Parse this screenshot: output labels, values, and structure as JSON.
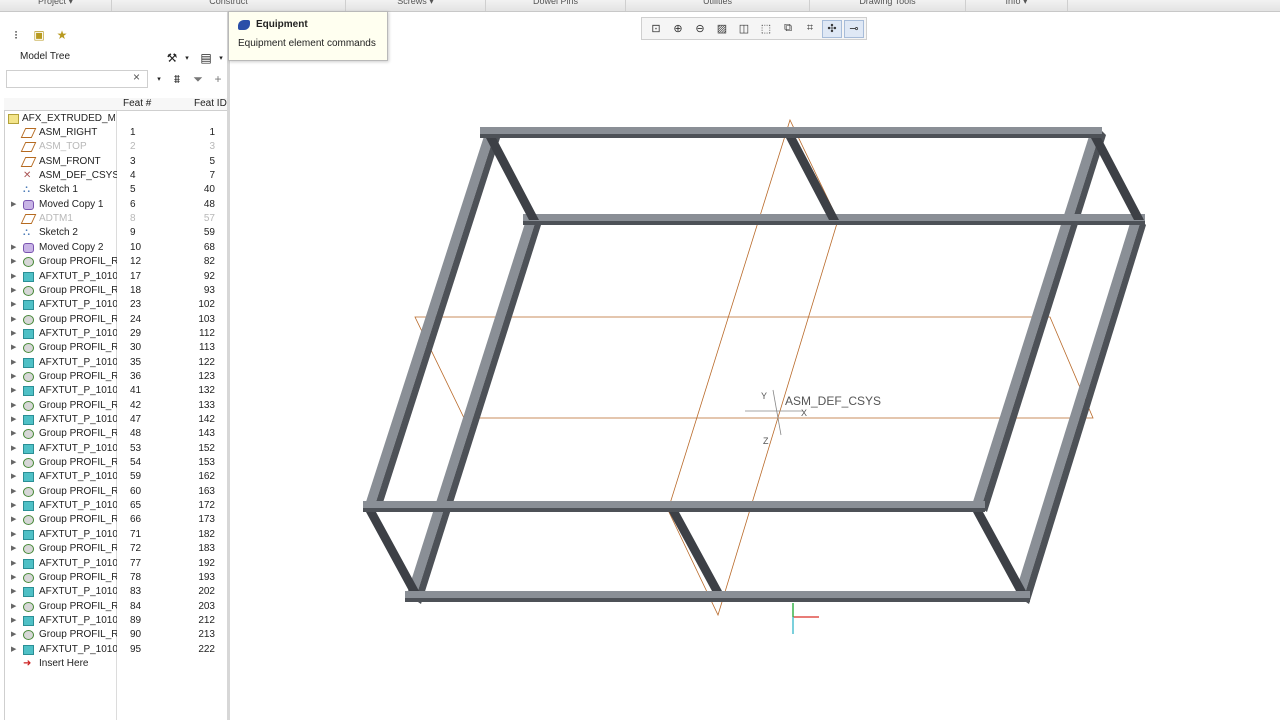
{
  "ribbon_groups": [
    "Project ▾",
    "Construct",
    "Screws ▾",
    "Dowel Pins",
    "Utilities",
    "Drawing Tools",
    "Info ▾"
  ],
  "model_tree": {
    "title": "Model Tree",
    "filter_value": "",
    "col_feat_num": "Feat #",
    "col_feat_id": "Feat ID",
    "root": "AFX_EXTRUDED_MA",
    "rows": [
      {
        "name": "ASM_RIGHT",
        "num": "1",
        "id": "1",
        "icon": "datum-plane-icon",
        "exp": false,
        "dim": false
      },
      {
        "name": "ASM_TOP",
        "num": "2",
        "id": "3",
        "icon": "datum-plane-icon",
        "exp": false,
        "dim": true
      },
      {
        "name": "ASM_FRONT",
        "num": "3",
        "id": "5",
        "icon": "datum-plane-icon",
        "exp": false,
        "dim": false
      },
      {
        "name": "ASM_DEF_CSYS",
        "num": "4",
        "id": "7",
        "icon": "csys-icon",
        "exp": false,
        "dim": false
      },
      {
        "name": "Sketch 1",
        "num": "5",
        "id": "40",
        "icon": "sketch-icon",
        "exp": false,
        "dim": false
      },
      {
        "name": "Moved Copy 1",
        "num": "6",
        "id": "48",
        "icon": "moved-copy-icon",
        "exp": true,
        "dim": false
      },
      {
        "name": "ADTM1",
        "num": "8",
        "id": "57",
        "icon": "datum-plane-icon",
        "exp": false,
        "dim": true
      },
      {
        "name": "Sketch 2",
        "num": "9",
        "id": "59",
        "icon": "sketch-icon",
        "exp": false,
        "dim": false
      },
      {
        "name": "Moved Copy 2",
        "num": "10",
        "id": "68",
        "icon": "moved-copy-icon",
        "exp": true,
        "dim": false
      },
      {
        "name": "Group PROFIL_R",
        "num": "12",
        "id": "82",
        "icon": "group-icon",
        "exp": true,
        "dim": false
      },
      {
        "name": "AFXTUT_P_1010_",
        "num": "17",
        "id": "92",
        "icon": "part-icon",
        "exp": true,
        "dim": false
      },
      {
        "name": "Group PROFIL_R",
        "num": "18",
        "id": "93",
        "icon": "group-icon",
        "exp": true,
        "dim": false
      },
      {
        "name": "AFXTUT_P_1010_",
        "num": "23",
        "id": "102",
        "icon": "part-icon",
        "exp": true,
        "dim": false
      },
      {
        "name": "Group PROFIL_R",
        "num": "24",
        "id": "103",
        "icon": "group-icon",
        "exp": true,
        "dim": false
      },
      {
        "name": "AFXTUT_P_1010_",
        "num": "29",
        "id": "112",
        "icon": "part-icon",
        "exp": true,
        "dim": false
      },
      {
        "name": "Group PROFIL_R",
        "num": "30",
        "id": "113",
        "icon": "group-icon",
        "exp": true,
        "dim": false
      },
      {
        "name": "AFXTUT_P_1010_",
        "num": "35",
        "id": "122",
        "icon": "part-icon",
        "exp": true,
        "dim": false
      },
      {
        "name": "Group PROFIL_R",
        "num": "36",
        "id": "123",
        "icon": "group-icon",
        "exp": true,
        "dim": false
      },
      {
        "name": "AFXTUT_P_1010_",
        "num": "41",
        "id": "132",
        "icon": "part-icon",
        "exp": true,
        "dim": false
      },
      {
        "name": "Group PROFIL_R",
        "num": "42",
        "id": "133",
        "icon": "group-icon",
        "exp": true,
        "dim": false
      },
      {
        "name": "AFXTUT_P_1010_",
        "num": "47",
        "id": "142",
        "icon": "part-icon",
        "exp": true,
        "dim": false
      },
      {
        "name": "Group PROFIL_R",
        "num": "48",
        "id": "143",
        "icon": "group-icon",
        "exp": true,
        "dim": false
      },
      {
        "name": "AFXTUT_P_1010_",
        "num": "53",
        "id": "152",
        "icon": "part-icon",
        "exp": true,
        "dim": false
      },
      {
        "name": "Group PROFIL_R",
        "num": "54",
        "id": "153",
        "icon": "group-icon",
        "exp": true,
        "dim": false
      },
      {
        "name": "AFXTUT_P_1010_",
        "num": "59",
        "id": "162",
        "icon": "part-icon",
        "exp": true,
        "dim": false
      },
      {
        "name": "Group PROFIL_R",
        "num": "60",
        "id": "163",
        "icon": "group-icon",
        "exp": true,
        "dim": false
      },
      {
        "name": "AFXTUT_P_1010_",
        "num": "65",
        "id": "172",
        "icon": "part-icon",
        "exp": true,
        "dim": false
      },
      {
        "name": "Group PROFIL_R",
        "num": "66",
        "id": "173",
        "icon": "group-icon",
        "exp": true,
        "dim": false
      },
      {
        "name": "AFXTUT_P_1010_",
        "num": "71",
        "id": "182",
        "icon": "part-icon",
        "exp": true,
        "dim": false
      },
      {
        "name": "Group PROFIL_R",
        "num": "72",
        "id": "183",
        "icon": "group-icon",
        "exp": true,
        "dim": false
      },
      {
        "name": "AFXTUT_P_1010_",
        "num": "77",
        "id": "192",
        "icon": "part-icon",
        "exp": true,
        "dim": false
      },
      {
        "name": "Group PROFIL_R",
        "num": "78",
        "id": "193",
        "icon": "group-icon",
        "exp": true,
        "dim": false
      },
      {
        "name": "AFXTUT_P_1010_",
        "num": "83",
        "id": "202",
        "icon": "part-icon",
        "exp": true,
        "dim": false
      },
      {
        "name": "Group PROFIL_R",
        "num": "84",
        "id": "203",
        "icon": "group-icon",
        "exp": true,
        "dim": false
      },
      {
        "name": "AFXTUT_P_1010_",
        "num": "89",
        "id": "212",
        "icon": "part-icon",
        "exp": true,
        "dim": false
      },
      {
        "name": "Group PROFIL_R",
        "num": "90",
        "id": "213",
        "icon": "group-icon",
        "exp": true,
        "dim": false
      },
      {
        "name": "AFXTUT_P_1010_",
        "num": "95",
        "id": "222",
        "icon": "part-icon",
        "exp": true,
        "dim": false
      }
    ],
    "insert_here": "Insert Here"
  },
  "tooltip": {
    "title": "Equipment",
    "description": "Equipment element commands"
  },
  "graphics_toolbar": [
    "refit-icon",
    "zoom-in-icon",
    "zoom-out-icon",
    "repaint-icon",
    "display-style-icon",
    "saved-views-icon",
    "view-manager-icon",
    "datum-display-icon",
    "spin-center-icon",
    "annotation-display-icon"
  ],
  "viewport": {
    "csys_label": "ASM_DEF_CSYS",
    "axis_y": "Y",
    "axis_z": "Z",
    "axis_x": "X"
  },
  "colors": {
    "datum_orange": "#b96a2a",
    "profile_gray": "#8a8f96",
    "profile_dark": "#4d5157"
  }
}
